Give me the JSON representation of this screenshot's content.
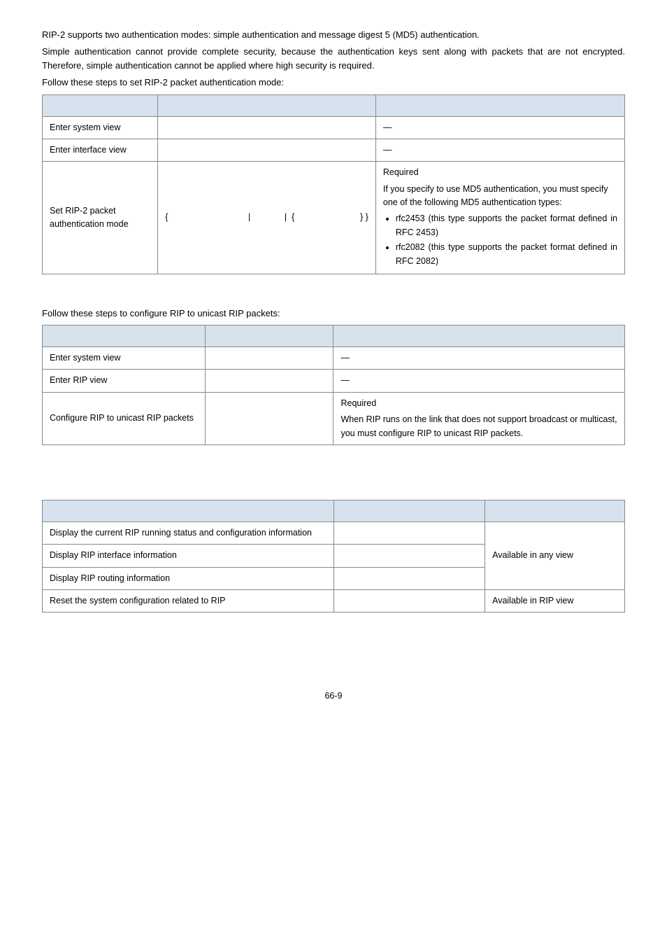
{
  "intro": {
    "p1": "RIP-2 supports two authentication modes: simple authentication and message digest 5 (MD5) authentication.",
    "p2": "Simple authentication cannot provide complete security, because the authentication keys sent along with packets that are not encrypted. Therefore, simple authentication cannot be applied where high security is required.",
    "p3": "Follow these steps to set RIP-2 packet authentication mode:"
  },
  "table1": {
    "r1c1": "Enter system view",
    "r1c3": "—",
    "r2c1": "Enter interface view",
    "r2c3": "—",
    "r3c1": "Set RIP-2 packet authentication mode",
    "r3c2": "{                                 |              |  {                           } }",
    "r3c3_req": "Required",
    "r3c3_sub": "If you specify to use MD5 authentication, you must specify one of the following MD5 authentication types:",
    "r3c3_li1": "rfc2453 (this type supports the packet format defined in RFC 2453)",
    "r3c3_li2": "rfc2082 (this type supports the packet format defined in RFC 2082)"
  },
  "mid": {
    "p1": "Follow these steps to configure RIP to unicast RIP packets:"
  },
  "table2": {
    "r1c1": "Enter system view",
    "r1c3": "—",
    "r2c1": "Enter RIP view",
    "r2c3": "—",
    "r3c1": "Configure RIP to unicast RIP packets",
    "r3c3_req": "Required",
    "r3c3_sub": "When RIP runs on the link that does not support broadcast or multicast, you must configure RIP to unicast RIP packets."
  },
  "table3": {
    "r1c1": "Display the current RIP running status and configuration information",
    "r2c1": "Display RIP interface information",
    "r3c1": "Display RIP routing information",
    "r4c1": "Reset the system configuration related to RIP",
    "col3_span": "Available in any view",
    "r4c3": "Available in RIP view"
  },
  "footer": "66-9"
}
